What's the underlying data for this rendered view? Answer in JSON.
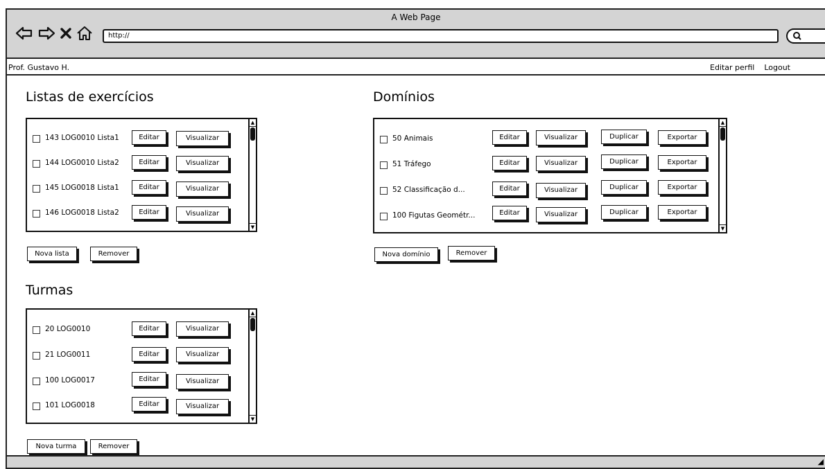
{
  "window": {
    "title": "A Web Page",
    "url": "http://"
  },
  "topbar": {
    "user": "Prof. Gustavo H.",
    "edit_profile": "Editar perfil",
    "logout": "Logout"
  },
  "listas": {
    "title": "Listas de exercícios",
    "items": [
      {
        "label": "143 LOG0010 Lista1",
        "edit": "Editar",
        "view": "Visualizar"
      },
      {
        "label": "144 LOG0010 Lista2",
        "edit": "Editar",
        "view": "Visualizar"
      },
      {
        "label": "145 LOG0018 Lista1",
        "edit": "Editar",
        "view": "Visualizar"
      },
      {
        "label": "146 LOG0018 Lista2",
        "edit": "Editar",
        "view": "Visualizar"
      }
    ],
    "new_button": "Nova lista",
    "remove_button": "Remover"
  },
  "turmas": {
    "title": "Turmas",
    "items": [
      {
        "label": "20 LOG0010",
        "edit": "Editar",
        "view": "Visualizar"
      },
      {
        "label": "21 LOG0011",
        "edit": "Editar",
        "view": "Visualizar"
      },
      {
        "label": "100 LOG0017",
        "edit": "Editar",
        "view": "Visualizar"
      },
      {
        "label": "101 LOG0018",
        "edit": "Editar",
        "view": "Visualizar"
      }
    ],
    "new_button": "Nova turma",
    "remove_button": "Remover"
  },
  "dominios": {
    "title": "Domínios",
    "items": [
      {
        "label": "50 Animais",
        "edit": "Editar",
        "view": "Visualizar",
        "duplicate": "Duplicar",
        "export": "Exportar"
      },
      {
        "label": "51 Tráfego",
        "edit": "Editar",
        "view": "Visualizar",
        "duplicate": "Duplicar",
        "export": "Exportar"
      },
      {
        "label": "52 Classificação d...",
        "edit": "Editar",
        "view": "Visualizar",
        "duplicate": "Duplicar",
        "export": "Exportar"
      },
      {
        "label": "100 Figutas Geométr...",
        "edit": "Editar",
        "view": "Visualizar",
        "duplicate": "Duplicar",
        "export": "Exportar"
      }
    ],
    "new_button": "Nova domínio",
    "remove_button": "Remover"
  }
}
